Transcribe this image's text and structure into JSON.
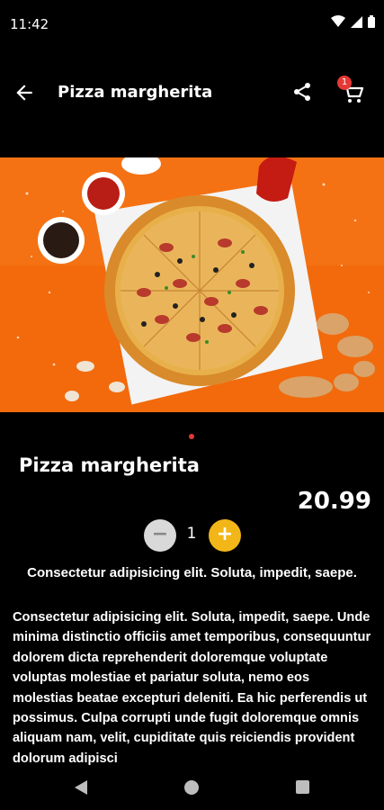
{
  "status": {
    "time": "11:42"
  },
  "appbar": {
    "title": "Pizza margherita",
    "cart_count": "1"
  },
  "product": {
    "name": "Pizza margherita",
    "price": "20.99",
    "quantity": "1",
    "minus_label": "−",
    "plus_label": "+",
    "subtitle": "Consectetur adipisicing elit. Soluta, impedit, saepe.",
    "description": "Consectetur adipisicing elit. Soluta, impedit, saepe. Unde minima distinctio officiis amet temporibus, consequuntur dolorem dicta reprehenderit doloremque voluptate voluptas molestiae et pariatur soluta, nemo eos molestias beatae excepturi deleniti. Ea hic perferendis ut possimus. Culpa corrupti unde fugit doloremque omnis aliquam nam, velit, cupiditate quis reiciendis provident dolorum adipisci"
  },
  "carousel": {
    "page": 1,
    "total": 1
  },
  "colors": {
    "accent": "#e53935",
    "plus": "#f2b619",
    "minus": "#d9d9d9",
    "hero_bg": "#f26a0c"
  }
}
